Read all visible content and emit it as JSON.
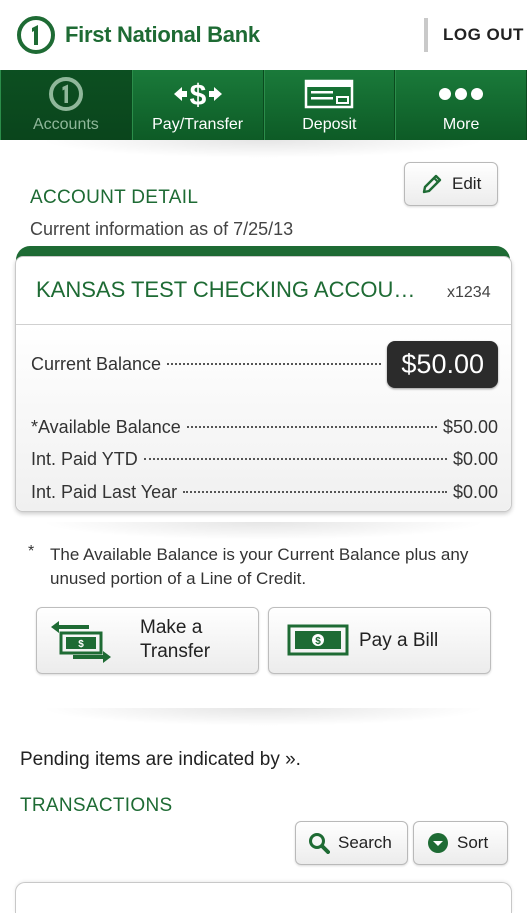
{
  "header": {
    "bank_name": "First National Bank",
    "logout_label": "LOG OUT"
  },
  "nav": {
    "tabs": [
      {
        "label": "Accounts",
        "icon": "accounts-logo-icon",
        "active": true
      },
      {
        "label": "Pay/Transfer",
        "icon": "dollar-arrows-icon",
        "active": false
      },
      {
        "label": "Deposit",
        "icon": "check-icon",
        "active": false
      },
      {
        "label": "More",
        "icon": "more-dots-icon",
        "active": false
      }
    ]
  },
  "account_detail": {
    "title": "ACCOUNT DETAIL",
    "as_of": "Current information as of 7/25/13",
    "edit_label": "Edit"
  },
  "account": {
    "name": "KANSAS TEST CHECKING ACCOU…",
    "number": "x1234",
    "rows": [
      {
        "label": "Current Balance",
        "value": "$50.00"
      },
      {
        "label": "*Available Balance",
        "value": "$50.00"
      },
      {
        "label": "Int. Paid YTD",
        "value": "$0.00"
      },
      {
        "label": "Int. Paid Last Year",
        "value": "$0.00"
      }
    ]
  },
  "note": {
    "star": "*",
    "text": "The Available Balance is your Current Balance plus any unused portion of a Line of Credit."
  },
  "actions": {
    "transfer_line1": "Make a",
    "transfer_line2": "Transfer",
    "pay_bill": "Pay a Bill"
  },
  "transactions": {
    "pending_text": "Pending items are indicated by ».",
    "title": "TRANSACTIONS",
    "search_label": "Search",
    "sort_label": "Sort"
  },
  "colors": {
    "brand_green": "#1e6b34",
    "nav_green": "#0e5a26",
    "balance_pill": "#2b2b2b"
  }
}
